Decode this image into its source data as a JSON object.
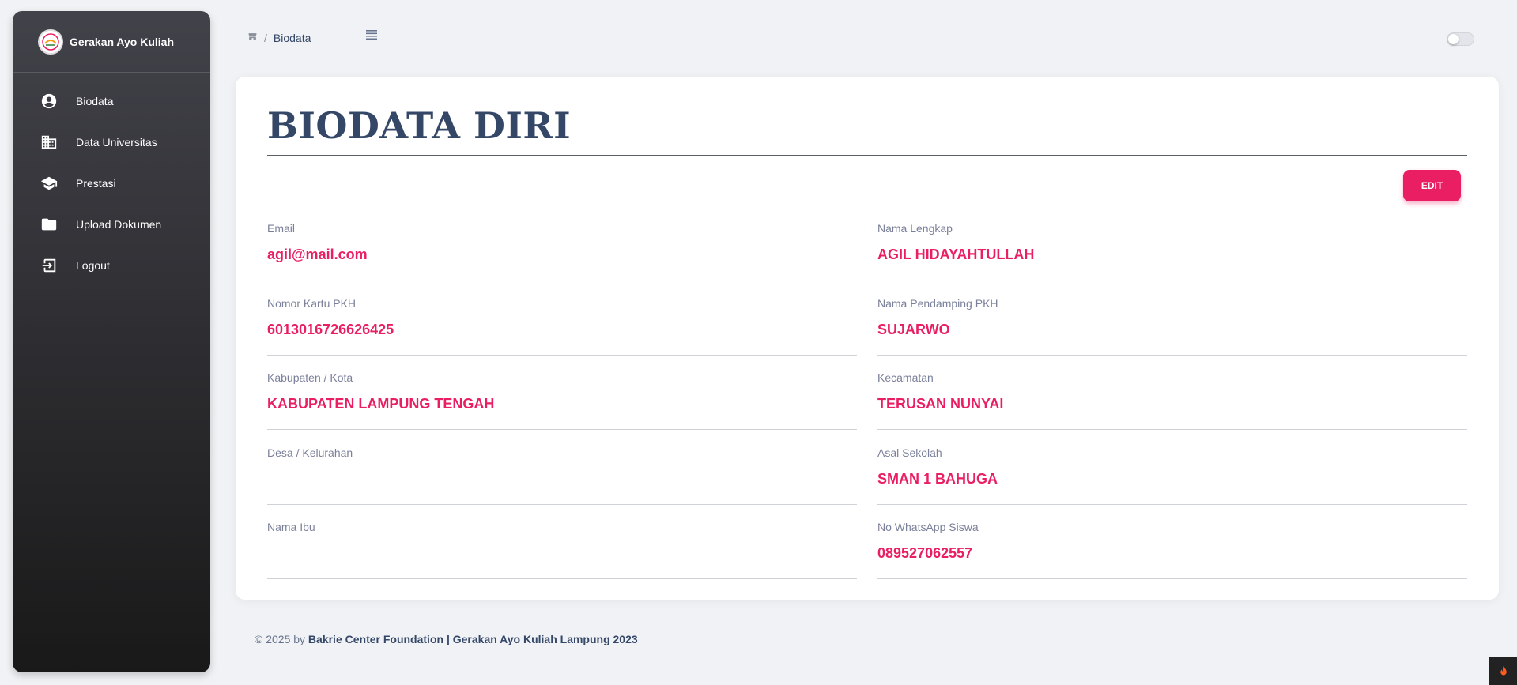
{
  "brand": {
    "name": "Gerakan Ayo Kuliah"
  },
  "sidebar": {
    "items": [
      {
        "label": "Biodata",
        "icon": "account-circle-icon"
      },
      {
        "label": "Data Universitas",
        "icon": "building-icon"
      },
      {
        "label": "Prestasi",
        "icon": "graduation-cap-icon"
      },
      {
        "label": "Upload Dokumen",
        "icon": "folder-icon"
      },
      {
        "label": "Logout",
        "icon": "logout-icon"
      }
    ]
  },
  "breadcrumb": {
    "separator": "/",
    "current": "Biodata"
  },
  "card": {
    "title": "BIODATA DIRI",
    "edit_label": "EDIT",
    "fields": [
      {
        "label": "Email",
        "value": "agil@mail.com"
      },
      {
        "label": "Nama Lengkap",
        "value": "AGIL HIDAYAHTULLAH"
      },
      {
        "label": "Nomor Kartu PKH",
        "value": "6013016726626425"
      },
      {
        "label": "Nama Pendamping PKH",
        "value": "SUJARWO"
      },
      {
        "label": "Kabupaten / Kota",
        "value": "KABUPATEN LAMPUNG TENGAH"
      },
      {
        "label": "Kecamatan",
        "value": "TERUSAN NUNYAI"
      },
      {
        "label": "Desa / Kelurahan",
        "value": ""
      },
      {
        "label": "Asal Sekolah",
        "value": "SMAN 1 BAHUGA"
      },
      {
        "label": "Nama Ibu",
        "value": ""
      },
      {
        "label": "No WhatsApp Siswa",
        "value": "089527062557"
      }
    ]
  },
  "footer": {
    "prefix": "© 2025 by",
    "org": "Bakrie Center Foundation | Gerakan Ayo Kuliah Lampung 2023"
  },
  "colors": {
    "accent": "#e91e63",
    "heading": "#344767",
    "sidebar_top": "#42424a",
    "sidebar_bottom": "#191919"
  }
}
